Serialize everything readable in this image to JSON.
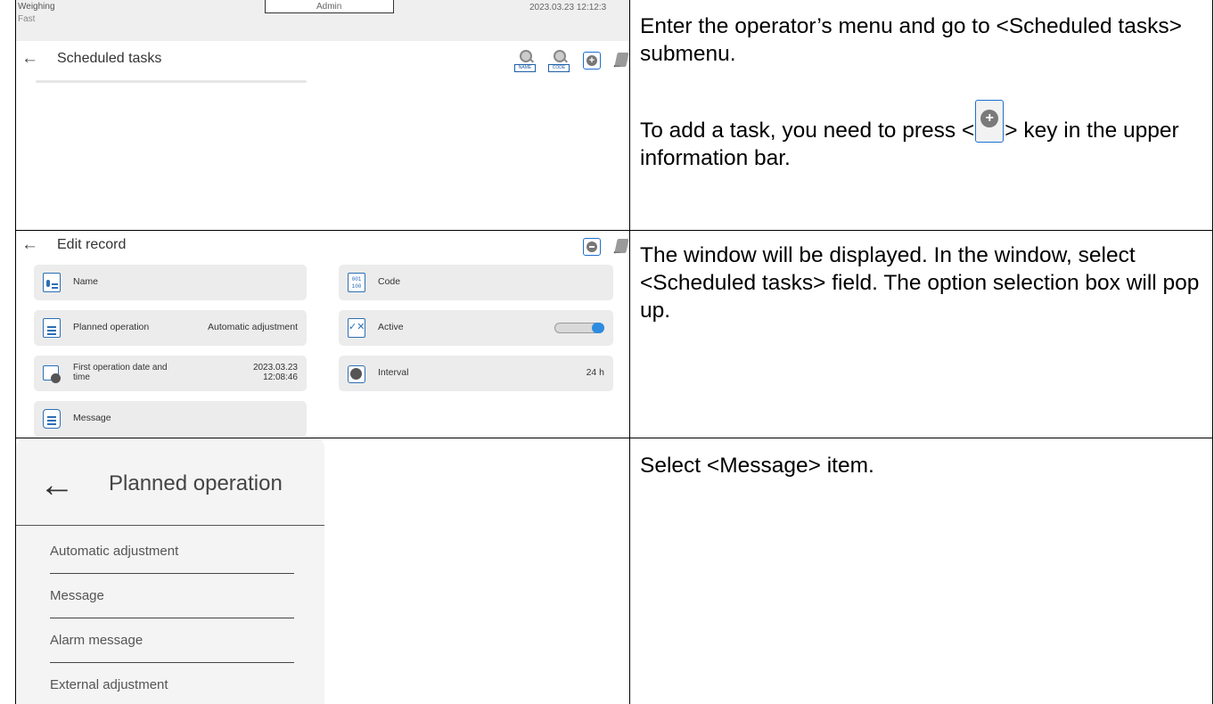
{
  "steps": [
    {
      "screen": {
        "topbar": {
          "mode": "Weighing",
          "speed": "Fast",
          "user": "Admin",
          "datetime": "2023.03.23 12:12:3"
        },
        "back_glyph": "←",
        "title": "Scheduled tasks",
        "icons": [
          "search-name-icon",
          "search-code-icon",
          "add-icon",
          "exit-icon"
        ],
        "icon_labels": {
          "name": "NAME",
          "code": "CODE"
        }
      },
      "text": {
        "p1": "Enter the operator’s menu and go to <Scheduled tasks> submenu.",
        "p2_before": "To add a task, you need to press <",
        "p2_after": "> key in the upper information bar."
      }
    },
    {
      "screen": {
        "back_glyph": "←",
        "title": "Edit record",
        "fields": {
          "name": {
            "label": "Name"
          },
          "code": {
            "label": "Code"
          },
          "planned_operation": {
            "label": "Planned operation",
            "value": "Automatic adjustment"
          },
          "active": {
            "label": "Active",
            "value": "on"
          },
          "first_operation": {
            "label": "First operation date and time",
            "date": "2023.03.23",
            "time": "12:08:46"
          },
          "interval": {
            "label": "Interval",
            "value": "24 h"
          },
          "message": {
            "label": "Message"
          }
        }
      },
      "text": {
        "p1": "The window will be displayed. In the window, select <Scheduled tasks> field. The option selection box will pop up."
      }
    },
    {
      "screen": {
        "back_glyph": "←",
        "title": "Planned operation",
        "options": [
          "Automatic adjustment",
          "Message",
          "Alarm message",
          "External adjustment"
        ]
      },
      "text": {
        "p1": "Select <Message> item."
      }
    }
  ]
}
